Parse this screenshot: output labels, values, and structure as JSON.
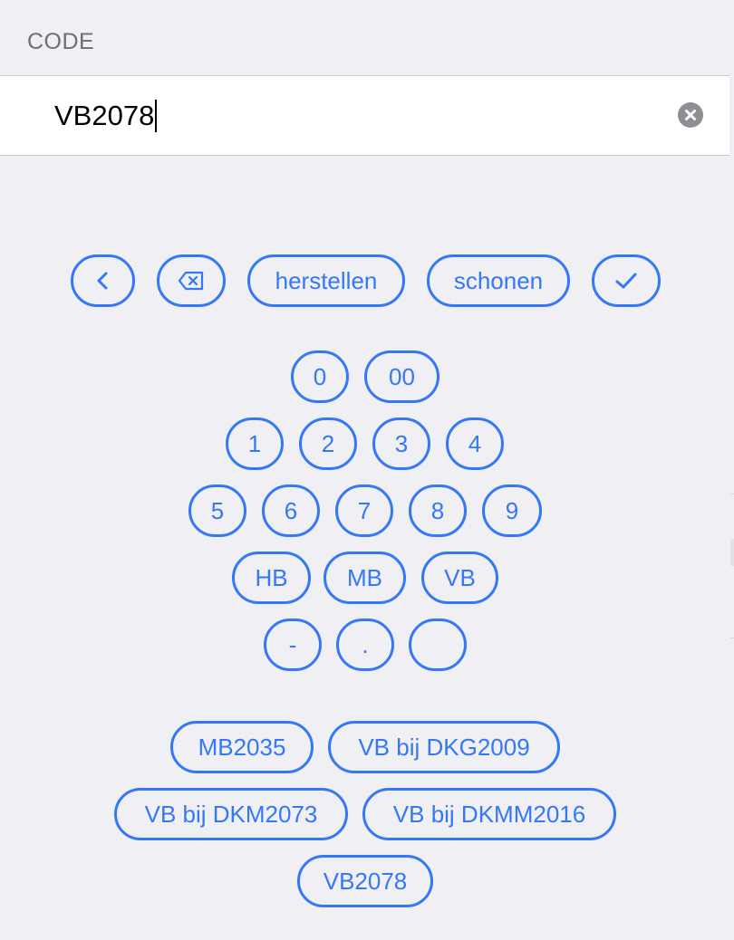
{
  "field": {
    "label": "CODE",
    "value": "VB2078"
  },
  "toolbar": {
    "back_icon": "chevron-left-icon",
    "delete_icon": "backspace-icon",
    "reset_label": "herstellen",
    "clean_label": "schonen",
    "confirm_icon": "checkmark-icon"
  },
  "keypad": {
    "row0": [
      "0",
      "00"
    ],
    "row1": [
      "1",
      "2",
      "3",
      "4"
    ],
    "row2": [
      "5",
      "6",
      "7",
      "8",
      "9"
    ],
    "row3": [
      "HB",
      "MB",
      "VB"
    ],
    "row4": [
      "-",
      ".",
      ""
    ]
  },
  "suggestions": [
    "MB2035",
    "VB bij DKG2009",
    "VB bij DKM2073",
    "VB bij DKMM2016",
    "VB2078"
  ],
  "colors": {
    "accent": "#3478f6",
    "background": "#efeff4",
    "label": "#6d6d72"
  }
}
